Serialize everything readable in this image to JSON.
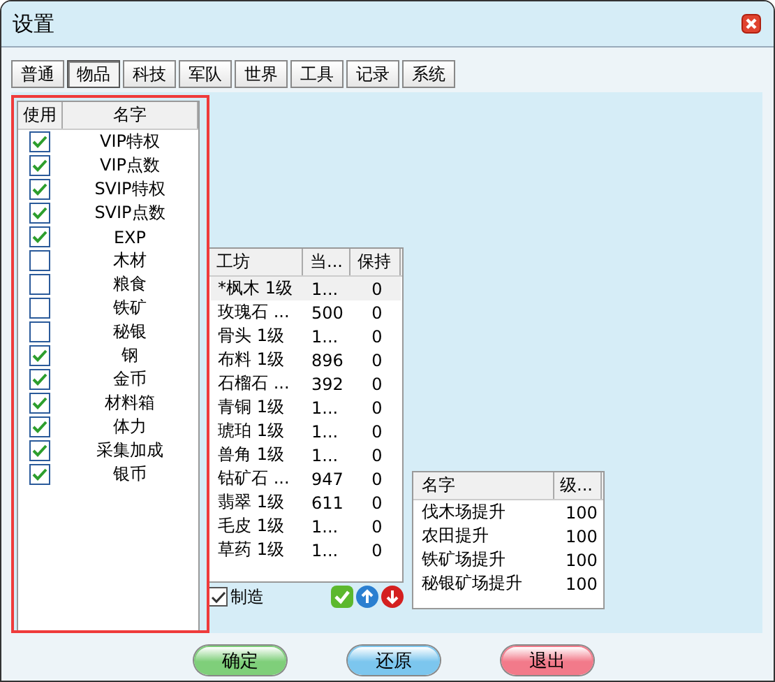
{
  "window": {
    "title": "设置"
  },
  "tabs": [
    {
      "label": "普通",
      "selected": false
    },
    {
      "label": "物品",
      "selected": true
    },
    {
      "label": "科技",
      "selected": false
    },
    {
      "label": "军队",
      "selected": false
    },
    {
      "label": "世界",
      "selected": false
    },
    {
      "label": "工具",
      "selected": false
    },
    {
      "label": "记录",
      "selected": false
    },
    {
      "label": "系统",
      "selected": false
    }
  ],
  "items_table": {
    "columns": [
      "使用",
      "名字"
    ],
    "rows": [
      {
        "name": "VIP特权",
        "checked": true
      },
      {
        "name": "VIP点数",
        "checked": true
      },
      {
        "name": "SVIP特权",
        "checked": true
      },
      {
        "name": "SVIP点数",
        "checked": true
      },
      {
        "name": "EXP",
        "checked": true
      },
      {
        "name": "木材",
        "checked": false
      },
      {
        "name": "粮食",
        "checked": false
      },
      {
        "name": "铁矿",
        "checked": false
      },
      {
        "name": "秘银",
        "checked": false
      },
      {
        "name": "钢",
        "checked": true
      },
      {
        "name": "金币",
        "checked": true
      },
      {
        "name": "材料箱",
        "checked": true
      },
      {
        "name": "体力",
        "checked": true
      },
      {
        "name": "采集加成",
        "checked": true
      },
      {
        "name": "银币",
        "checked": true
      }
    ]
  },
  "workshop_table": {
    "columns": [
      "工坊",
      "当...",
      "保持"
    ],
    "rows": [
      {
        "cells": [
          "*枫木 1级",
          "1...",
          "0"
        ],
        "selected": true
      },
      {
        "cells": [
          "玫瑰石 ...",
          "500",
          "0"
        ],
        "selected": false
      },
      {
        "cells": [
          "骨头 1级",
          "1...",
          "0"
        ],
        "selected": false
      },
      {
        "cells": [
          "布料 1级",
          "896",
          "0"
        ],
        "selected": false
      },
      {
        "cells": [
          "石榴石 ...",
          "392",
          "0"
        ],
        "selected": false
      },
      {
        "cells": [
          "青铜 1级",
          "1...",
          "0"
        ],
        "selected": false
      },
      {
        "cells": [
          "琥珀 1级",
          "1...",
          "0"
        ],
        "selected": false
      },
      {
        "cells": [
          "兽角 1级",
          "1...",
          "0"
        ],
        "selected": false
      },
      {
        "cells": [
          "钴矿石 ...",
          "947",
          "0"
        ],
        "selected": false
      },
      {
        "cells": [
          "翡翠 1级",
          "611",
          "0"
        ],
        "selected": false
      },
      {
        "cells": [
          "毛皮 1级",
          "1...",
          "0"
        ],
        "selected": false
      },
      {
        "cells": [
          "草药 1级",
          "1...",
          "0"
        ],
        "selected": false
      }
    ],
    "craft_checkbox": {
      "label": "制造",
      "checked": true
    }
  },
  "upgrade_table": {
    "columns": [
      "名字",
      "级..."
    ],
    "rows": [
      {
        "cells": [
          "伐木场提升",
          "100"
        ]
      },
      {
        "cells": [
          "农田提升",
          "100"
        ]
      },
      {
        "cells": [
          "铁矿场提升",
          "100"
        ]
      },
      {
        "cells": [
          "秘银矿场提升",
          "100"
        ]
      }
    ]
  },
  "buttons": [
    {
      "label": "确定",
      "color": "#7fcf7a"
    },
    {
      "label": "还原",
      "color": "#7cc6ee"
    },
    {
      "label": "退出",
      "color": "#f27a8a"
    }
  ]
}
